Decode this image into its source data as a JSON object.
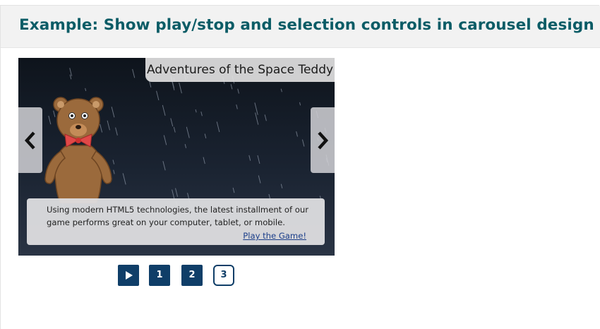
{
  "header": {
    "title": "Example: Show play/stop and selection controls in carousel design"
  },
  "carousel": {
    "slide_title": "Adventures of the Space Teddy",
    "caption_text": "Using modern HTML5 technologies, the latest installment of our game performs great on your computer, tablet, or mobile.",
    "caption_link": "Play the Game!",
    "prev_icon": "chevron-left-icon",
    "next_icon": "chevron-right-icon"
  },
  "controls": {
    "play_icon": "play-icon",
    "slides": [
      "1",
      "2",
      "3"
    ],
    "active_slide": "3"
  },
  "colors": {
    "title": "#0b5c66",
    "control_bg": "#0f3e68",
    "header_bg": "#f2f2f2"
  }
}
